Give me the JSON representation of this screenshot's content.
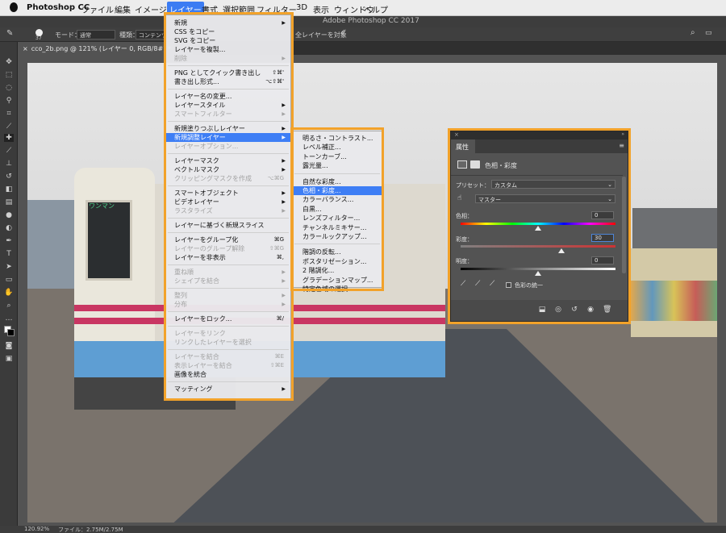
{
  "menubar": {
    "app": "Photoshop CC",
    "items": [
      "ファイル",
      "編集",
      "イメージ",
      "レイヤー",
      "書式",
      "選択範囲",
      "フィルター",
      "3D",
      "表示",
      "ウィンドウ",
      "ヘルプ"
    ]
  },
  "window_title": "Adobe Photoshop CC 2017",
  "options_bar": {
    "brush_size": "37",
    "mode_label": "モード：",
    "mode_value": "通常",
    "type_label": "種類：",
    "type_value": "コンテンツ",
    "sample_all": "全レイヤーを対象"
  },
  "document_tab": "cco_2b.png @ 121% (レイヤー 0, RGB/8#) *",
  "layer_menu": {
    "items": [
      {
        "label": "新規",
        "shortcut": "",
        "arrow": "▶",
        "disabled": false,
        "highlight": false
      },
      {
        "label": "CSS をコピー",
        "shortcut": "",
        "arrow": "",
        "disabled": false,
        "highlight": false
      },
      {
        "label": "SVG をコピー",
        "shortcut": "",
        "arrow": "",
        "disabled": false,
        "highlight": false
      },
      {
        "label": "レイヤーを複製...",
        "shortcut": "",
        "arrow": "",
        "disabled": false,
        "highlight": false
      },
      {
        "label": "削除",
        "shortcut": "",
        "arrow": "▶",
        "disabled": true,
        "highlight": false
      },
      {
        "label": "PNG としてクイック書き出し",
        "shortcut": "⇧⌘'",
        "arrow": "",
        "disabled": false,
        "highlight": false
      },
      {
        "label": "書き出し形式...",
        "shortcut": "⌥⇧⌘'",
        "arrow": "",
        "disabled": false,
        "highlight": false
      },
      {
        "label": "レイヤー名の変更...",
        "shortcut": "",
        "arrow": "",
        "disabled": false,
        "highlight": false
      },
      {
        "label": "レイヤースタイル",
        "shortcut": "",
        "arrow": "▶",
        "disabled": false,
        "highlight": false
      },
      {
        "label": "スマートフィルター",
        "shortcut": "",
        "arrow": "▶",
        "disabled": true,
        "highlight": false
      },
      {
        "label": "新規塗りつぶしレイヤー",
        "shortcut": "",
        "arrow": "▶",
        "disabled": false,
        "highlight": false
      },
      {
        "label": "新規調整レイヤー",
        "shortcut": "",
        "arrow": "▶",
        "disabled": false,
        "highlight": true
      },
      {
        "label": "レイヤーオプション...",
        "shortcut": "",
        "arrow": "",
        "disabled": true,
        "highlight": false
      },
      {
        "label": "レイヤーマスク",
        "shortcut": "",
        "arrow": "▶",
        "disabled": false,
        "highlight": false
      },
      {
        "label": "ベクトルマスク",
        "shortcut": "",
        "arrow": "▶",
        "disabled": false,
        "highlight": false
      },
      {
        "label": "クリッピングマスクを作成",
        "shortcut": "⌥⌘G",
        "arrow": "",
        "disabled": true,
        "highlight": false
      },
      {
        "label": "スマートオブジェクト",
        "shortcut": "",
        "arrow": "▶",
        "disabled": false,
        "highlight": false
      },
      {
        "label": "ビデオレイヤー",
        "shortcut": "",
        "arrow": "▶",
        "disabled": false,
        "highlight": false
      },
      {
        "label": "ラスタライズ",
        "shortcut": "",
        "arrow": "▶",
        "disabled": true,
        "highlight": false
      },
      {
        "label": "レイヤーに基づく新規スライス",
        "shortcut": "",
        "arrow": "",
        "disabled": false,
        "highlight": false
      },
      {
        "label": "レイヤーをグループ化",
        "shortcut": "⌘G",
        "arrow": "",
        "disabled": false,
        "highlight": false
      },
      {
        "label": "レイヤーのグループ解除",
        "shortcut": "⇧⌘G",
        "arrow": "",
        "disabled": true,
        "highlight": false
      },
      {
        "label": "レイヤーを非表示",
        "shortcut": "⌘,",
        "arrow": "",
        "disabled": false,
        "highlight": false
      },
      {
        "label": "重ね順",
        "shortcut": "",
        "arrow": "▶",
        "disabled": true,
        "highlight": false
      },
      {
        "label": "シェイプを結合",
        "shortcut": "",
        "arrow": "▶",
        "disabled": true,
        "highlight": false
      },
      {
        "label": "整列",
        "shortcut": "",
        "arrow": "▶",
        "disabled": true,
        "highlight": false
      },
      {
        "label": "分布",
        "shortcut": "",
        "arrow": "▶",
        "disabled": true,
        "highlight": false
      },
      {
        "label": "レイヤーをロック...",
        "shortcut": "⌘/",
        "arrow": "",
        "disabled": false,
        "highlight": false
      },
      {
        "label": "レイヤーをリンク",
        "shortcut": "",
        "arrow": "",
        "disabled": true,
        "highlight": false
      },
      {
        "label": "リンクしたレイヤーを選択",
        "shortcut": "",
        "arrow": "",
        "disabled": true,
        "highlight": false
      },
      {
        "label": "レイヤーを結合",
        "shortcut": "⌘E",
        "arrow": "",
        "disabled": true,
        "highlight": false
      },
      {
        "label": "表示レイヤーを結合",
        "shortcut": "⇧⌘E",
        "arrow": "",
        "disabled": true,
        "highlight": false
      },
      {
        "label": "画像を統合",
        "shortcut": "",
        "arrow": "",
        "disabled": false,
        "highlight": false
      },
      {
        "label": "マッティング",
        "shortcut": "",
        "arrow": "▶",
        "disabled": false,
        "highlight": false
      }
    ]
  },
  "adjustment_submenu": {
    "items": [
      {
        "label": "明るさ・コントラスト...",
        "highlight": false
      },
      {
        "label": "レベル補正...",
        "highlight": false
      },
      {
        "label": "トーンカーブ...",
        "highlight": false
      },
      {
        "label": "露光量...",
        "highlight": false
      },
      {
        "label": "自然な彩度...",
        "highlight": false
      },
      {
        "label": "色相・彩度...",
        "highlight": true
      },
      {
        "label": "カラーバランス...",
        "highlight": false
      },
      {
        "label": "白黒...",
        "highlight": false
      },
      {
        "label": "レンズフィルター...",
        "highlight": false
      },
      {
        "label": "チャンネルミキサー...",
        "highlight": false
      },
      {
        "label": "カラールックアップ...",
        "highlight": false
      },
      {
        "label": "階調の反転...",
        "highlight": false
      },
      {
        "label": "ポスタリゼーション...",
        "highlight": false
      },
      {
        "label": "2 階調化...",
        "highlight": false
      },
      {
        "label": "グラデーションマップ...",
        "highlight": false
      },
      {
        "label": "特定色域の選択...",
        "highlight": false
      }
    ]
  },
  "properties": {
    "tab": "属性",
    "adjustment_title": "色相・彩度",
    "preset_label": "プリセット：",
    "preset_value": "カスタム",
    "channel_value": "マスター",
    "hue_label": "色相：",
    "hue_value": "0",
    "saturation_label": "彩度：",
    "saturation_value": "30",
    "lightness_label": "明度：",
    "lightness_value": "0",
    "colorize_label": "色彩の統一",
    "hue_fraction": 0.5,
    "saturation_fraction": 0.65,
    "lightness_fraction": 0.5
  },
  "status": {
    "zoom": "120.92%",
    "file": "ファイル：2.75M/2.75M"
  },
  "photo_label": "ワンマン",
  "colors": {
    "accent_orange": "#f2a22a",
    "highlight_blue": "#3e7ef5"
  }
}
